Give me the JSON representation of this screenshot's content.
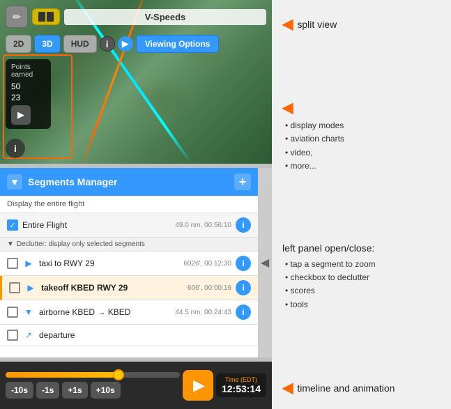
{
  "toolbar": {
    "v_speeds_label": "V-Speeds",
    "edit_icon": "✏",
    "split_view_label": "split view"
  },
  "mode_bar": {
    "btn_2d": "2D",
    "btn_3d": "3D",
    "btn_hud": "HUD",
    "info_label": "i",
    "arrow_label": "▶",
    "viewing_options_label": "Viewing Options",
    "display_modes": "display modes",
    "aviation_charts": "aviation charts",
    "video": "video,",
    "more": "more..."
  },
  "points": {
    "title": "Points\nearned",
    "val1": "50",
    "val2": "23"
  },
  "segments": {
    "header_title": "Segments Manager",
    "add_label": "+",
    "flight_display_label": "Display the entire flight",
    "entire_flight_label": "Entire Flight",
    "entire_flight_stats": "49.0 nm, 00:56:10",
    "declutter_label": "Declutter: display only selected segments",
    "rows": [
      {
        "name": "taxi to RWY 29",
        "stats": "6026', 00:12:30",
        "icon": "▶",
        "bold": false
      },
      {
        "name": "takeoff KBED RWY 29",
        "stats": "606', 00:00:16",
        "icon": "▶",
        "bold": true
      },
      {
        "name": "airborne KBED → KBED",
        "stats": "44.5 nm, 00:24:43",
        "icon": "▼",
        "bold": false
      },
      {
        "name": "departure",
        "stats": "",
        "icon": "↗",
        "bold": false
      }
    ],
    "left_panel_annotation": "left panel open/close:",
    "bullets": [
      "tap a segment to zoom",
      "checkbox to declutter",
      "scores",
      "tools"
    ]
  },
  "timeline": {
    "btn_minus10": "-10s",
    "btn_minus1": "-1s",
    "btn_plus1": "+1s",
    "btn_plus10": "+10s",
    "time_label": "Time (EDT)",
    "time_value": "12:53:14",
    "annotation": "timeline and animation",
    "progress": 65
  }
}
